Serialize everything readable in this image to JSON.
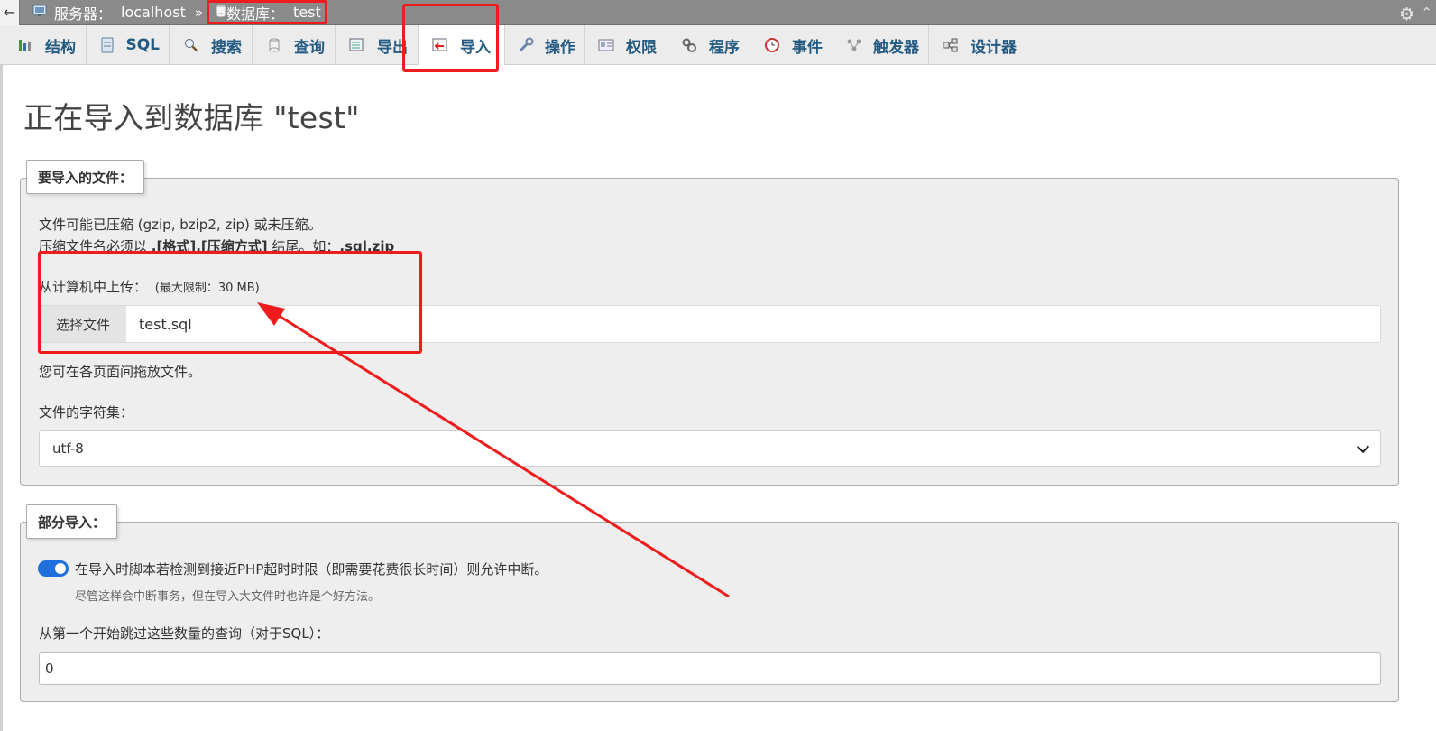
{
  "topbar": {
    "back_label": "←",
    "server_label": "服务器：",
    "server_value": "localhost",
    "separator": "»",
    "db_label": "数据库：",
    "db_value": "test"
  },
  "tabs": [
    {
      "label": "结构",
      "icon": "structure-icon",
      "active": false
    },
    {
      "label": "SQL",
      "icon": "sql-icon",
      "active": false
    },
    {
      "label": "搜索",
      "icon": "search-icon",
      "active": false
    },
    {
      "label": "查询",
      "icon": "query-icon",
      "active": false
    },
    {
      "label": "导出",
      "icon": "export-icon",
      "active": false
    },
    {
      "label": "导入",
      "icon": "import-icon",
      "active": true
    },
    {
      "label": "操作",
      "icon": "wrench-icon",
      "active": false
    },
    {
      "label": "权限",
      "icon": "privileges-icon",
      "active": false
    },
    {
      "label": "程序",
      "icon": "routines-icon",
      "active": false
    },
    {
      "label": "事件",
      "icon": "events-icon",
      "active": false
    },
    {
      "label": "触发器",
      "icon": "triggers-icon",
      "active": false
    },
    {
      "label": "设计器",
      "icon": "designer-icon",
      "active": false
    }
  ],
  "page_title": "正在导入到数据库 \"test\"",
  "file_section": {
    "legend": "要导入的文件：",
    "line1": "文件可能已压缩 (gzip, bzip2, zip) 或未压缩。",
    "line2_prefix": "压缩文件名必须以 ",
    "line2_bold": ".[格式].[压缩方式]",
    "line2_mid": " 结尾。如：",
    "line2_example": ".sql.zip",
    "upload_label": "从计算机中上传：",
    "upload_limit": "(最大限制：30 MB)",
    "choose_file_button": "选择文件",
    "chosen_file": "test.sql",
    "drag_hint": "您可在各页面间拖放文件。",
    "charset_label": "文件的字符集：",
    "charset_value": "utf-8"
  },
  "partial_section": {
    "legend": "部分导入：",
    "interrupt_label": "在导入时脚本若检测到接近PHP超时时限（即需要花费很长时间）则允许中断。",
    "interrupt_enabled": true,
    "interrupt_hint": "尽管这样会中断事务，但在导入大文件时也许是个好方法。",
    "skip_label": "从第一个开始跳过这些数量的查询（对于SQL）：",
    "skip_value": "0"
  },
  "colors": {
    "tab_text": "#235a81",
    "annotation_red": "#ee1c1c",
    "toggle_on": "#1f6fdc"
  }
}
